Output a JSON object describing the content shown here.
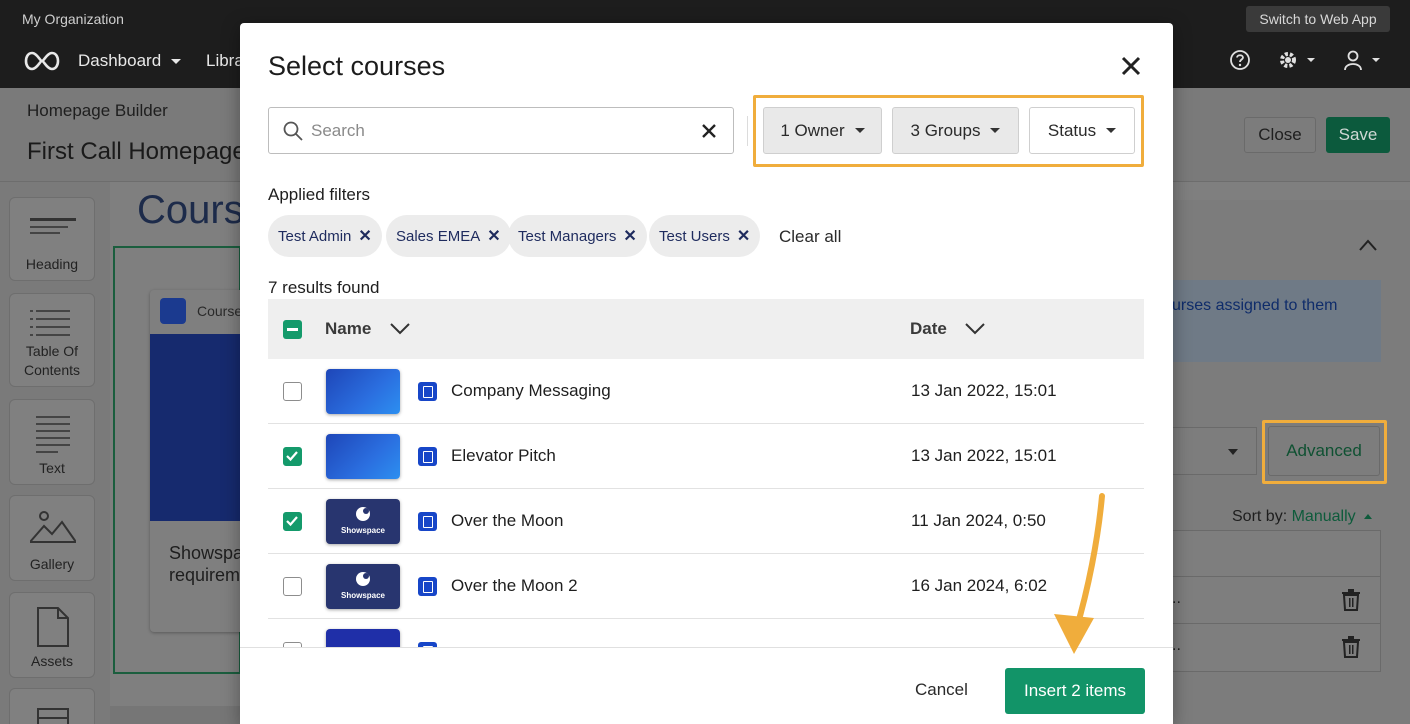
{
  "app": {
    "org_name": "My Organization",
    "switch_label": "Switch to Web App",
    "nav": {
      "dashboard": "Dashboard",
      "library": "Libra"
    }
  },
  "page": {
    "breadcrumb": "Homepage Builder",
    "title": "First Call Homepage",
    "close_label": "Close",
    "save_label": "Save",
    "canvas_title": "Cours",
    "card_label": "Course",
    "card_text_1": "Showspa",
    "card_text_2": "requirem",
    "tools": [
      "Heading",
      "Table Of Contents",
      "Text",
      "Gallery",
      "Assets"
    ],
    "info_text": "urses assigned to them",
    "advanced_label": "Advanced",
    "sort_by_label": "Sort by:",
    "sort_by_value": "Manually",
    "row_ellipsis": ".."
  },
  "modal": {
    "title": "Select courses",
    "search_placeholder": "Search",
    "filters": {
      "owner": "1 Owner",
      "groups": "3 Groups",
      "status": "Status"
    },
    "applied_filters_label": "Applied filters",
    "chips": [
      "Test Admin",
      "Sales EMEA",
      "Test Managers",
      "Test Users"
    ],
    "clear_all": "Clear all",
    "results_count": "7 results found",
    "columns": {
      "name": "Name",
      "date": "Date"
    },
    "rows": [
      {
        "name": "Company Messaging",
        "date": "13 Jan 2022, 15:01",
        "checked": false,
        "thumb": "blue"
      },
      {
        "name": "Elevator Pitch",
        "date": "13 Jan 2022, 15:01",
        "checked": true,
        "thumb": "blue"
      },
      {
        "name": "Over the Moon",
        "date": "11 Jan 2024, 0:50",
        "checked": true,
        "thumb": "navy"
      },
      {
        "name": "Over the Moon 2",
        "date": "16 Jan 2024, 6:02",
        "checked": false,
        "thumb": "navy"
      }
    ],
    "thumb_brand": "Showspace",
    "cancel_label": "Cancel",
    "insert_label": "Insert 2 items"
  },
  "colors": {
    "accent_green": "#129468",
    "highlight_orange": "#f0ad3c",
    "course_icon_blue": "#1746c8"
  }
}
